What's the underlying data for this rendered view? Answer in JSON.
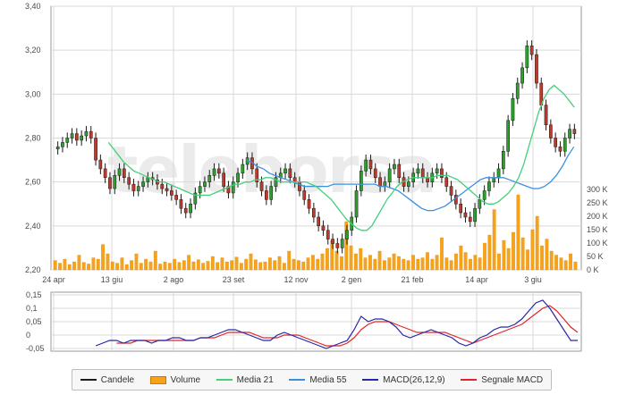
{
  "watermark": "teleborsa",
  "colors": {
    "candle": "#1a1a1a",
    "candle_up": "#2e9e2e",
    "candle_down": "#c0392b",
    "volume": "#f6a21b",
    "ma21": "#45d07a",
    "ma55": "#3c8fe0",
    "macd": "#2727a8",
    "signal": "#e0252a",
    "grid": "#d9d9d9",
    "border": "#9a9a9a"
  },
  "legend": [
    {
      "label": "Candele",
      "icon": "candle-line-icon",
      "color": "#1a1a1a",
      "kind": "line"
    },
    {
      "label": "Volume",
      "icon": "volume-bar-icon",
      "color": "#f6a21b",
      "kind": "box"
    },
    {
      "label": "Media 21",
      "icon": "ma21-line-icon",
      "color": "#45d07a",
      "kind": "line"
    },
    {
      "label": "Media 55",
      "icon": "ma55-line-icon",
      "color": "#3c8fe0",
      "kind": "line"
    },
    {
      "label": "MACD(26,12,9)",
      "icon": "macd-line-icon",
      "color": "#2727a8",
      "kind": "line"
    },
    {
      "label": "Segnale MACD",
      "icon": "signal-line-icon",
      "color": "#e0252a",
      "kind": "line"
    }
  ],
  "chart_data": [
    {
      "type": "candlestick",
      "title": "",
      "x_ticks": [
        "24 apr",
        "13 giu",
        "2 ago",
        "23 set",
        "12 nov",
        "2 gen",
        "21 feb",
        "14 apr",
        "3 giu"
      ],
      "y_ticks": [
        "3,40",
        "3,20",
        "3,00",
        "2,80",
        "2,60",
        "2,40",
        "2,20"
      ],
      "ylim": [
        2.2,
        3.4
      ],
      "grid": true,
      "close_series": [
        2.76,
        2.78,
        2.8,
        2.82,
        2.79,
        2.81,
        2.83,
        2.8,
        2.7,
        2.66,
        2.62,
        2.57,
        2.63,
        2.66,
        2.62,
        2.59,
        2.56,
        2.58,
        2.6,
        2.62,
        2.61,
        2.59,
        2.57,
        2.56,
        2.54,
        2.52,
        2.48,
        2.46,
        2.5,
        2.55,
        2.58,
        2.6,
        2.63,
        2.66,
        2.64,
        2.58,
        2.55,
        2.6,
        2.64,
        2.68,
        2.71,
        2.66,
        2.6,
        2.56,
        2.52,
        2.58,
        2.62,
        2.64,
        2.66,
        2.62,
        2.6,
        2.56,
        2.52,
        2.48,
        2.44,
        2.4,
        2.38,
        2.34,
        2.32,
        2.3,
        2.34,
        2.38,
        2.44,
        2.56,
        2.65,
        2.7,
        2.66,
        2.62,
        2.58,
        2.6,
        2.66,
        2.68,
        2.62,
        2.58,
        2.6,
        2.64,
        2.66,
        2.62,
        2.6,
        2.64,
        2.66,
        2.62,
        2.58,
        2.54,
        2.5,
        2.46,
        2.44,
        2.42,
        2.48,
        2.52,
        2.56,
        2.6,
        2.62,
        2.66,
        2.74,
        2.88,
        2.98,
        3.05,
        3.12,
        3.22,
        3.18,
        3.05,
        2.95,
        2.86,
        2.8,
        2.76,
        2.74,
        2.8,
        2.84,
        2.82
      ],
      "ma21": [
        null,
        null,
        null,
        null,
        null,
        null,
        null,
        null,
        null,
        null,
        2.78,
        2.75,
        2.72,
        2.69,
        2.67,
        2.65,
        2.64,
        2.63,
        2.62,
        2.61,
        2.6,
        2.6,
        2.59,
        2.58,
        2.57,
        2.56,
        2.55,
        2.54,
        2.54,
        2.54,
        2.54,
        2.55,
        2.56,
        2.57,
        2.58,
        2.59,
        2.59,
        2.6,
        2.6,
        2.61,
        2.61,
        2.62,
        2.62,
        2.61,
        2.6,
        2.6,
        2.6,
        2.6,
        2.6,
        2.6,
        2.59,
        2.58,
        2.56,
        2.54,
        2.52,
        2.49,
        2.46,
        2.43,
        2.41,
        2.39,
        2.38,
        2.38,
        2.4,
        2.44,
        2.48,
        2.52,
        2.55,
        2.58,
        2.6,
        2.61,
        2.62,
        2.62,
        2.62,
        2.62,
        2.62,
        2.63,
        2.63,
        2.63,
        2.62,
        2.61,
        2.59,
        2.57,
        2.55,
        2.53,
        2.51,
        2.5,
        2.5,
        2.51,
        2.53,
        2.55,
        2.58,
        2.62,
        2.68,
        2.76,
        2.84,
        2.92,
        2.98,
        3.02,
        3.04,
        3.02,
        3.0,
        2.97,
        2.94
      ],
      "ma55": [
        null,
        null,
        null,
        null,
        null,
        null,
        null,
        null,
        null,
        null,
        null,
        null,
        null,
        null,
        null,
        null,
        null,
        null,
        null,
        null,
        2.7,
        2.69,
        2.67,
        2.66,
        2.64,
        2.63,
        2.62,
        2.61,
        2.6,
        2.59,
        2.58,
        2.58,
        2.58,
        2.58,
        2.58,
        2.59,
        2.59,
        2.59,
        2.59,
        2.59,
        2.59,
        2.59,
        2.59,
        2.58,
        2.58,
        2.57,
        2.56,
        2.54,
        2.52,
        2.5,
        2.48,
        2.47,
        2.47,
        2.48,
        2.49,
        2.51,
        2.53,
        2.55,
        2.57,
        2.59,
        2.61,
        2.62,
        2.62,
        2.62,
        2.62,
        2.61,
        2.6,
        2.59,
        2.58,
        2.57,
        2.57,
        2.58,
        2.6,
        2.63,
        2.67,
        2.72,
        2.76
      ],
      "ma55_start_index": 12
    },
    {
      "type": "bar",
      "title": "",
      "y_ticks": [
        "300 K",
        "250 K",
        "200 K",
        "150 K",
        "100 K",
        "50 K",
        "0 K"
      ],
      "ylim": [
        0,
        300000
      ],
      "volume_k": [
        35,
        25,
        40,
        20,
        30,
        55,
        28,
        22,
        45,
        40,
        95,
        60,
        30,
        25,
        45,
        20,
        35,
        60,
        25,
        40,
        30,
        70,
        22,
        30,
        25,
        40,
        28,
        35,
        55,
        30,
        38,
        25,
        32,
        50,
        28,
        45,
        30,
        35,
        48,
        25,
        40,
        60,
        38,
        28,
        30,
        45,
        35,
        50,
        25,
        70,
        40,
        35,
        30,
        45,
        55,
        40,
        60,
        80,
        110,
        70,
        50,
        180,
        90,
        60,
        80,
        45,
        55,
        40,
        70,
        35,
        45,
        60,
        50,
        40,
        35,
        55,
        40,
        45,
        65,
        40,
        55,
        120,
        45,
        35,
        60,
        90,
        65,
        40,
        55,
        45,
        100,
        130,
        225,
        60,
        110,
        80,
        140,
        280,
        120,
        75,
        150,
        200,
        90,
        115,
        70,
        55,
        45,
        35,
        60,
        30
      ],
      "grid": true
    },
    {
      "type": "line",
      "title": "",
      "y_ticks": [
        "0,15",
        "0,1",
        "0,05",
        "0",
        "-0,05"
      ],
      "ylim": [
        -0.06,
        0.16
      ],
      "series": [
        {
          "name": "MACD(26,12,9)",
          "values": [
            -0.04,
            -0.03,
            -0.02,
            -0.02,
            -0.03,
            -0.02,
            -0.02,
            -0.02,
            -0.03,
            -0.02,
            -0.02,
            -0.01,
            -0.01,
            -0.02,
            -0.02,
            -0.01,
            -0.01,
            0.0,
            0.01,
            0.02,
            0.02,
            0.01,
            0.0,
            -0.01,
            -0.02,
            -0.02,
            0.0,
            0.01,
            0.0,
            -0.01,
            -0.02,
            -0.03,
            -0.04,
            -0.05,
            -0.04,
            -0.03,
            -0.02,
            0.02,
            0.07,
            0.05,
            0.06,
            0.06,
            0.05,
            0.03,
            0.0,
            -0.01,
            0.0,
            0.01,
            0.02,
            0.01,
            0.0,
            -0.01,
            -0.03,
            -0.04,
            -0.03,
            -0.01,
            0.0,
            0.02,
            0.03,
            0.03,
            0.04,
            0.06,
            0.09,
            0.12,
            0.13,
            0.1,
            0.06,
            0.02,
            -0.02,
            -0.02
          ]
        },
        {
          "name": "Segnale MACD",
          "values": [
            null,
            null,
            null,
            -0.03,
            -0.03,
            -0.03,
            -0.02,
            -0.02,
            -0.02,
            -0.02,
            -0.02,
            -0.02,
            -0.02,
            -0.02,
            -0.02,
            -0.01,
            -0.01,
            -0.01,
            0.0,
            0.01,
            0.01,
            0.01,
            0.01,
            0.0,
            -0.01,
            -0.01,
            -0.01,
            0.0,
            0.0,
            0.0,
            -0.01,
            -0.02,
            -0.03,
            -0.04,
            -0.04,
            -0.04,
            -0.03,
            -0.01,
            0.02,
            0.04,
            0.05,
            0.05,
            0.05,
            0.04,
            0.03,
            0.02,
            0.01,
            0.01,
            0.01,
            0.01,
            0.01,
            0.0,
            -0.01,
            -0.02,
            -0.03,
            -0.02,
            -0.01,
            0.0,
            0.01,
            0.02,
            0.03,
            0.04,
            0.06,
            0.08,
            0.1,
            0.11,
            0.09,
            0.06,
            0.03,
            0.01
          ]
        }
      ],
      "grid": true
    }
  ]
}
